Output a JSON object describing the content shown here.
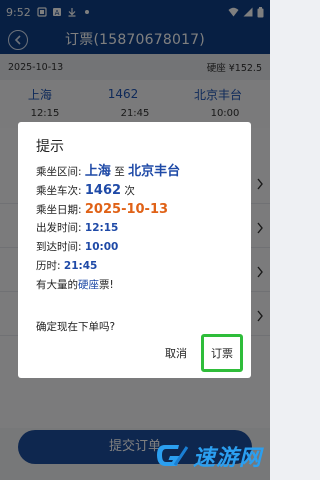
{
  "status_bar": {
    "time": "9:52",
    "icons": [
      "notification-icon",
      "app-icon",
      "download-icon",
      "dot-icon",
      "wifi-icon",
      "signal-icon",
      "battery-icon"
    ]
  },
  "app_bar": {
    "title": "订票(15870678017)"
  },
  "info_row": {
    "date": "2025-10-13",
    "seat_price": "硬座 ¥152.5"
  },
  "route_row": {
    "from": "上海",
    "train": "1462",
    "to": "北京丰台"
  },
  "times_row": {
    "depart": "12:15",
    "duration": "21:45",
    "arrive": "10:00"
  },
  "bottom_button": {
    "label": "提交订单"
  },
  "dialog": {
    "title": "提示",
    "section_label": "乘坐区间:",
    "from": "上海",
    "to_word": "至",
    "to": "北京丰台",
    "train_label": "乘坐车次:",
    "train": "1462",
    "train_suffix": "次",
    "date_label": "乘坐日期:",
    "date": "2025-10-13",
    "depart_label": "出发时间:",
    "depart": "12:15",
    "arrive_label": "到达时间:",
    "arrive": "10:00",
    "duration_label": "历时:",
    "duration": "21:45",
    "availability_prefix": "有大量的",
    "seat_type": "硬座",
    "availability_suffix": "票!",
    "confirm_question": "确定现在下单吗?",
    "cancel_label": "取消",
    "book_label": "订票"
  },
  "watermark": {
    "text": "速游网"
  },
  "colors": {
    "header": "#0f3f86",
    "accent_blue": "#1f4aa7",
    "accent_orange": "#e06217",
    "highlight_green": "#2fbd3a"
  }
}
